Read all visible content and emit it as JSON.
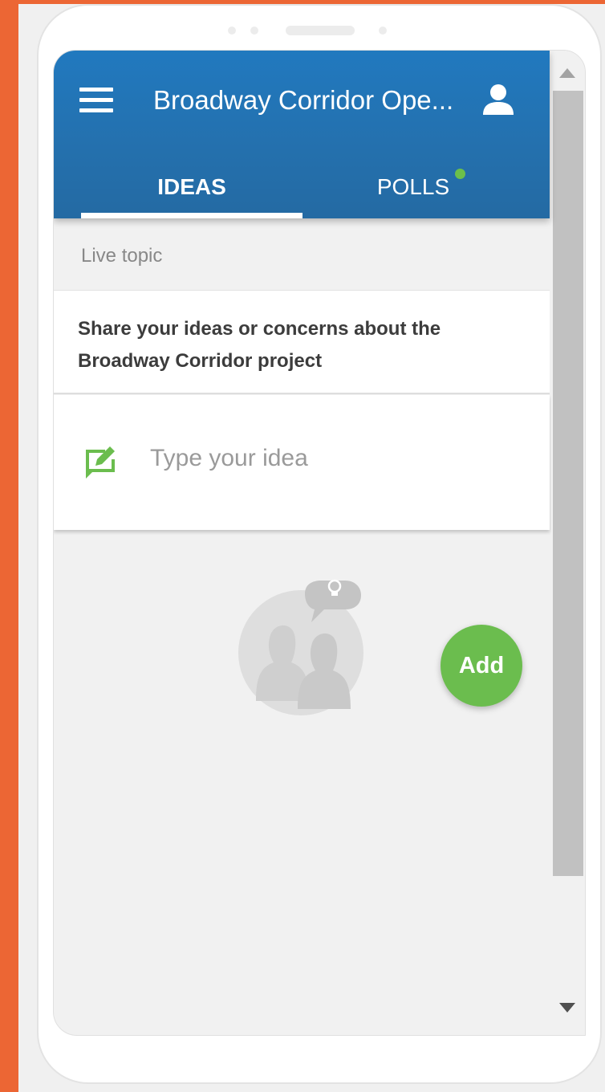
{
  "app": {
    "title": "Broadway Corridor Ope...",
    "tabs": [
      {
        "label": "IDEAS",
        "active": true
      },
      {
        "label": "POLLS",
        "active": false,
        "has_new": true
      }
    ]
  },
  "topic": {
    "section_label": "Live topic",
    "text": "Share your ideas or concerns about the Broadway Corridor project"
  },
  "idea_input": {
    "placeholder": "Type your idea"
  },
  "add_button": {
    "label": "Add"
  },
  "colors": {
    "accent_orange": "#ec6634",
    "appbar_blue": "#2179bf",
    "green": "#6bbd4e"
  },
  "icons": [
    "menu-icon",
    "user-icon",
    "edit-icon",
    "lightbulb-icon",
    "scroll-up-icon",
    "scroll-down-icon"
  ]
}
